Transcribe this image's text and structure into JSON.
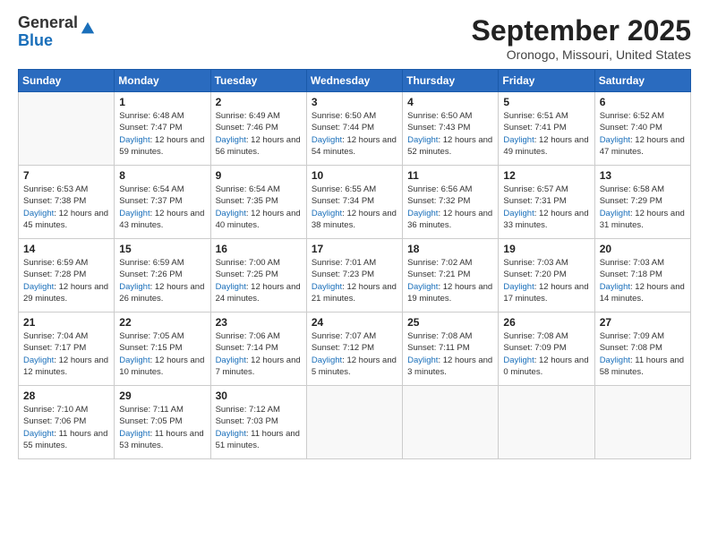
{
  "header": {
    "logo_line1": "General",
    "logo_line2": "Blue",
    "title": "September 2025",
    "subtitle": "Oronogo, Missouri, United States"
  },
  "days_of_week": [
    "Sunday",
    "Monday",
    "Tuesday",
    "Wednesday",
    "Thursday",
    "Friday",
    "Saturday"
  ],
  "weeks": [
    [
      {
        "day": "",
        "sunrise": "",
        "sunset": "",
        "daylight": ""
      },
      {
        "day": "1",
        "sunrise": "Sunrise: 6:48 AM",
        "sunset": "Sunset: 7:47 PM",
        "daylight": "Daylight: 12 hours and 59 minutes."
      },
      {
        "day": "2",
        "sunrise": "Sunrise: 6:49 AM",
        "sunset": "Sunset: 7:46 PM",
        "daylight": "Daylight: 12 hours and 56 minutes."
      },
      {
        "day": "3",
        "sunrise": "Sunrise: 6:50 AM",
        "sunset": "Sunset: 7:44 PM",
        "daylight": "Daylight: 12 hours and 54 minutes."
      },
      {
        "day": "4",
        "sunrise": "Sunrise: 6:50 AM",
        "sunset": "Sunset: 7:43 PM",
        "daylight": "Daylight: 12 hours and 52 minutes."
      },
      {
        "day": "5",
        "sunrise": "Sunrise: 6:51 AM",
        "sunset": "Sunset: 7:41 PM",
        "daylight": "Daylight: 12 hours and 49 minutes."
      },
      {
        "day": "6",
        "sunrise": "Sunrise: 6:52 AM",
        "sunset": "Sunset: 7:40 PM",
        "daylight": "Daylight: 12 hours and 47 minutes."
      }
    ],
    [
      {
        "day": "7",
        "sunrise": "Sunrise: 6:53 AM",
        "sunset": "Sunset: 7:38 PM",
        "daylight": "Daylight: 12 hours and 45 minutes."
      },
      {
        "day": "8",
        "sunrise": "Sunrise: 6:54 AM",
        "sunset": "Sunset: 7:37 PM",
        "daylight": "Daylight: 12 hours and 43 minutes."
      },
      {
        "day": "9",
        "sunrise": "Sunrise: 6:54 AM",
        "sunset": "Sunset: 7:35 PM",
        "daylight": "Daylight: 12 hours and 40 minutes."
      },
      {
        "day": "10",
        "sunrise": "Sunrise: 6:55 AM",
        "sunset": "Sunset: 7:34 PM",
        "daylight": "Daylight: 12 hours and 38 minutes."
      },
      {
        "day": "11",
        "sunrise": "Sunrise: 6:56 AM",
        "sunset": "Sunset: 7:32 PM",
        "daylight": "Daylight: 12 hours and 36 minutes."
      },
      {
        "day": "12",
        "sunrise": "Sunrise: 6:57 AM",
        "sunset": "Sunset: 7:31 PM",
        "daylight": "Daylight: 12 hours and 33 minutes."
      },
      {
        "day": "13",
        "sunrise": "Sunrise: 6:58 AM",
        "sunset": "Sunset: 7:29 PM",
        "daylight": "Daylight: 12 hours and 31 minutes."
      }
    ],
    [
      {
        "day": "14",
        "sunrise": "Sunrise: 6:59 AM",
        "sunset": "Sunset: 7:28 PM",
        "daylight": "Daylight: 12 hours and 29 minutes."
      },
      {
        "day": "15",
        "sunrise": "Sunrise: 6:59 AM",
        "sunset": "Sunset: 7:26 PM",
        "daylight": "Daylight: 12 hours and 26 minutes."
      },
      {
        "day": "16",
        "sunrise": "Sunrise: 7:00 AM",
        "sunset": "Sunset: 7:25 PM",
        "daylight": "Daylight: 12 hours and 24 minutes."
      },
      {
        "day": "17",
        "sunrise": "Sunrise: 7:01 AM",
        "sunset": "Sunset: 7:23 PM",
        "daylight": "Daylight: 12 hours and 21 minutes."
      },
      {
        "day": "18",
        "sunrise": "Sunrise: 7:02 AM",
        "sunset": "Sunset: 7:21 PM",
        "daylight": "Daylight: 12 hours and 19 minutes."
      },
      {
        "day": "19",
        "sunrise": "Sunrise: 7:03 AM",
        "sunset": "Sunset: 7:20 PM",
        "daylight": "Daylight: 12 hours and 17 minutes."
      },
      {
        "day": "20",
        "sunrise": "Sunrise: 7:03 AM",
        "sunset": "Sunset: 7:18 PM",
        "daylight": "Daylight: 12 hours and 14 minutes."
      }
    ],
    [
      {
        "day": "21",
        "sunrise": "Sunrise: 7:04 AM",
        "sunset": "Sunset: 7:17 PM",
        "daylight": "Daylight: 12 hours and 12 minutes."
      },
      {
        "day": "22",
        "sunrise": "Sunrise: 7:05 AM",
        "sunset": "Sunset: 7:15 PM",
        "daylight": "Daylight: 12 hours and 10 minutes."
      },
      {
        "day": "23",
        "sunrise": "Sunrise: 7:06 AM",
        "sunset": "Sunset: 7:14 PM",
        "daylight": "Daylight: 12 hours and 7 minutes."
      },
      {
        "day": "24",
        "sunrise": "Sunrise: 7:07 AM",
        "sunset": "Sunset: 7:12 PM",
        "daylight": "Daylight: 12 hours and 5 minutes."
      },
      {
        "day": "25",
        "sunrise": "Sunrise: 7:08 AM",
        "sunset": "Sunset: 7:11 PM",
        "daylight": "Daylight: 12 hours and 3 minutes."
      },
      {
        "day": "26",
        "sunrise": "Sunrise: 7:08 AM",
        "sunset": "Sunset: 7:09 PM",
        "daylight": "Daylight: 12 hours and 0 minutes."
      },
      {
        "day": "27",
        "sunrise": "Sunrise: 7:09 AM",
        "sunset": "Sunset: 7:08 PM",
        "daylight": "Daylight: 11 hours and 58 minutes."
      }
    ],
    [
      {
        "day": "28",
        "sunrise": "Sunrise: 7:10 AM",
        "sunset": "Sunset: 7:06 PM",
        "daylight": "Daylight: 11 hours and 55 minutes."
      },
      {
        "day": "29",
        "sunrise": "Sunrise: 7:11 AM",
        "sunset": "Sunset: 7:05 PM",
        "daylight": "Daylight: 11 hours and 53 minutes."
      },
      {
        "day": "30",
        "sunrise": "Sunrise: 7:12 AM",
        "sunset": "Sunset: 7:03 PM",
        "daylight": "Daylight: 11 hours and 51 minutes."
      },
      {
        "day": "",
        "sunrise": "",
        "sunset": "",
        "daylight": ""
      },
      {
        "day": "",
        "sunrise": "",
        "sunset": "",
        "daylight": ""
      },
      {
        "day": "",
        "sunrise": "",
        "sunset": "",
        "daylight": ""
      },
      {
        "day": "",
        "sunrise": "",
        "sunset": "",
        "daylight": ""
      }
    ]
  ]
}
